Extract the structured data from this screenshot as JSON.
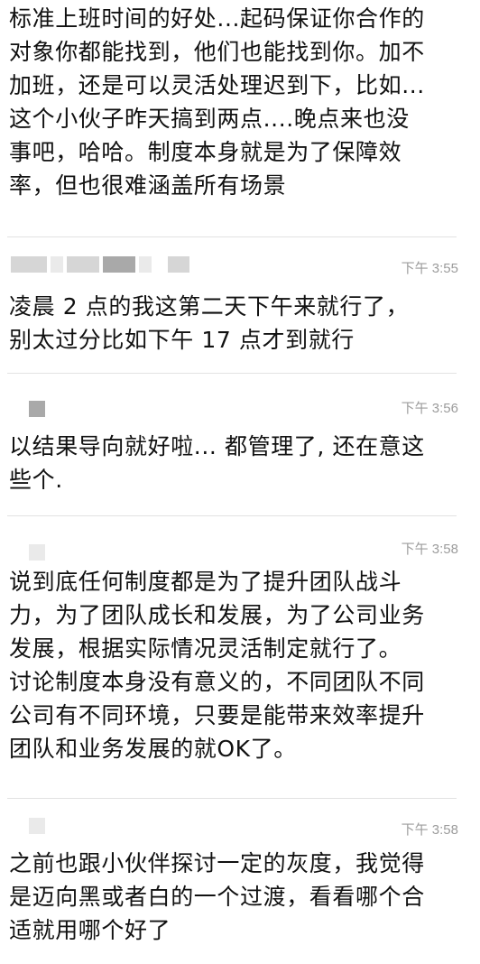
{
  "top_message": {
    "lines": [
      "标准上班时间的好处...起码保证你合作的",
      "对象你都能找到，他们也能找到你。加不",
      "加班，还是可以灵活处理迟到下，比如...",
      "这个小伙子昨天搞到两点....晚点来也没",
      "事吧，哈哈。制度本身就是为了保障效",
      "率，但也很难涵盖所有场景"
    ]
  },
  "comments": [
    {
      "time": "下午 3:55",
      "lines": [
        "凌晨 2 点的我这第二天下午来就行了，",
        "别太过分比如下午 17 点才到就行"
      ]
    },
    {
      "time": "下午 3:56",
      "lines": [
        "以结果导向就好啦...  都管理了, 还在意这",
        "些个."
      ]
    },
    {
      "time": "下午 3:58",
      "lines": [
        "说到底任何制度都是为了提升团队战斗",
        "力，为了团队成长和发展，为了公司业务",
        "发展，根据实际情况灵活制定就行了。",
        "讨论制度本身没有意义的，不同团队不同",
        "公司有不同环境，只要是能带来效率提升",
        "团队和业务发展的就OK了。"
      ]
    },
    {
      "time": "下午 3:58",
      "lines": [
        "之前也跟小伙伴探讨一定的灰度，我觉得",
        "是迈向黑或者白的一个过渡，看看哪个合",
        "适就用哪个好了"
      ]
    }
  ],
  "colors": {
    "text": "#111111",
    "timestamp": "#9c9c9c",
    "divider": "#e2e2e2",
    "name_blur": "#d6d6d6"
  }
}
